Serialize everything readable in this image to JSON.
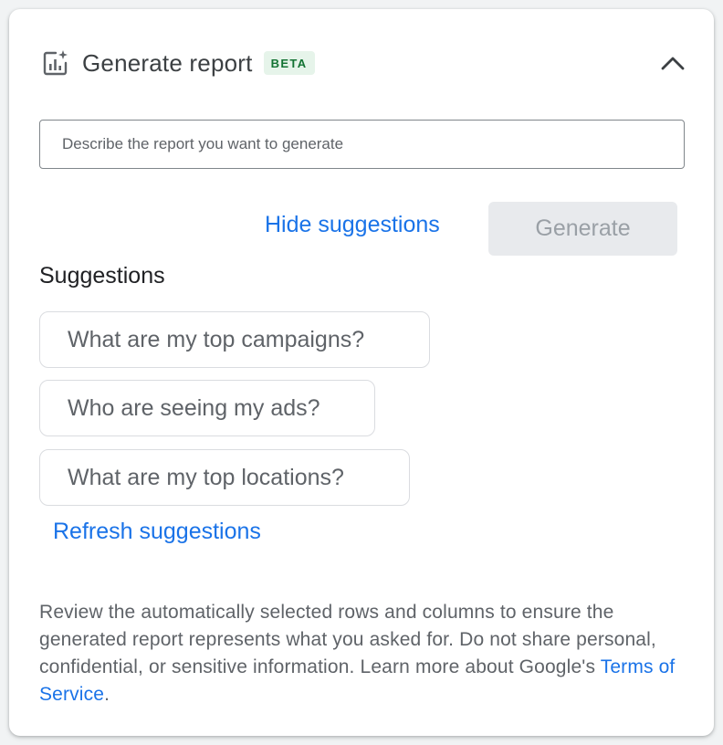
{
  "header": {
    "title": "Generate report",
    "badge": "BETA",
    "icon": "report-sparkle-icon",
    "collapse_icon": "chevron-up-icon"
  },
  "prompt": {
    "placeholder": "Describe the report you want to generate",
    "value": ""
  },
  "actions": {
    "hide_suggestions_label": "Hide suggestions",
    "generate_label": "Generate"
  },
  "suggestions": {
    "title": "Suggestions",
    "items": [
      "What are my top campaigns?",
      "Who are seeing my ads?",
      "What are my top locations?"
    ],
    "refresh_label": "Refresh suggestions"
  },
  "disclaimer": {
    "text_before_link": "Review the automatically selected rows and columns to ensure the generated report represents what you asked for. Do not share personal, confidential, or sensitive information. Learn more about Google's ",
    "link_text": "Terms of Service",
    "text_after_link": "."
  },
  "colors": {
    "link": "#1a73e8",
    "badge_bg": "#e6f4ea",
    "badge_text": "#137333",
    "disabled_button_bg": "#e8eaed",
    "disabled_button_text": "#9aa0a6"
  }
}
